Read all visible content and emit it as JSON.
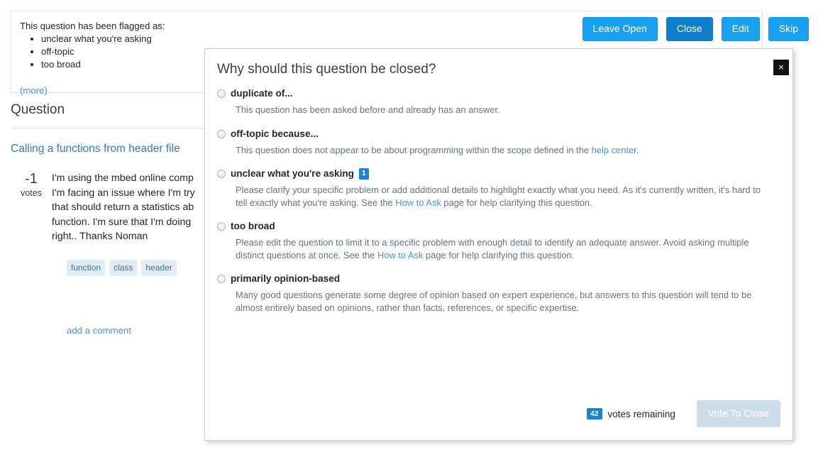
{
  "flag_panel": {
    "intro": "This question has been flagged as:",
    "reasons": [
      "unclear what you're asking",
      "off-topic",
      "too broad"
    ],
    "more_label": "(more)"
  },
  "review_actions": [
    {
      "label": "Leave Open",
      "state": "normal"
    },
    {
      "label": "Close",
      "state": "pressed"
    },
    {
      "label": "Edit",
      "state": "normal"
    },
    {
      "label": "Skip",
      "state": "normal"
    }
  ],
  "question": {
    "heading": "Question",
    "title": "Calling a functions from header file",
    "vote_count": "-1",
    "vote_label": "votes",
    "body": "I'm using the mbed online comp I'm facing an issue where I'm try that should return a statistics ab function. I'm sure that I'm doing right.. Thanks Noman",
    "tags": [
      "function",
      "class",
      "header"
    ],
    "add_comment": "add a comment"
  },
  "modal": {
    "title": "Why should this question be closed?",
    "close_icon": "×",
    "options": [
      {
        "label": "duplicate of...",
        "badge": null,
        "desc_parts": [
          {
            "text": "This question has been asked before and already has an answer.",
            "link": false
          }
        ]
      },
      {
        "label": "off-topic because...",
        "badge": null,
        "desc_parts": [
          {
            "text": "This question does not appear to be about programming within the scope defined in the ",
            "link": false
          },
          {
            "text": "help center",
            "link": true
          },
          {
            "text": ".",
            "link": false
          }
        ]
      },
      {
        "label": "unclear what you're asking",
        "badge": "1",
        "desc_parts": [
          {
            "text": "Please clarify your specific problem or add additional details to highlight exactly what you need. As it's currently written, it's hard to tell exactly what you're asking. See the ",
            "link": false
          },
          {
            "text": "How to Ask",
            "link": true
          },
          {
            "text": " page for help clarifying this question.",
            "link": false
          }
        ]
      },
      {
        "label": "too broad",
        "badge": null,
        "desc_parts": [
          {
            "text": "Please edit the question to limit it to a specific problem with enough detail to identify an adequate answer. Avoid asking multiple distinct questions at once. See the ",
            "link": false
          },
          {
            "text": "How to Ask",
            "link": true
          },
          {
            "text": " page for help clarifying this question.",
            "link": false
          }
        ]
      },
      {
        "label": "primarily opinion-based",
        "badge": null,
        "desc_parts": [
          {
            "text": "Many good questions generate some degree of opinion based on expert experience, but answers to this question will tend to be almost entirely based on opinions, rather than facts, references, or specific expertise.",
            "link": false
          }
        ]
      }
    ],
    "footer": {
      "votes_badge": "42",
      "votes_text": "votes remaining",
      "submit_label": "Vote To Close",
      "submit_disabled": true
    }
  },
  "colors": {
    "primary_blue": "#19a0f0",
    "pressed_blue": "#0f7fcc",
    "link_blue": "#3f99e0",
    "badge_blue": "#1a84d4",
    "tag_bg": "#e1ecf4",
    "tag_text": "#39739d",
    "disabled_btn": "#cfdde8",
    "close_black": "#111111"
  }
}
